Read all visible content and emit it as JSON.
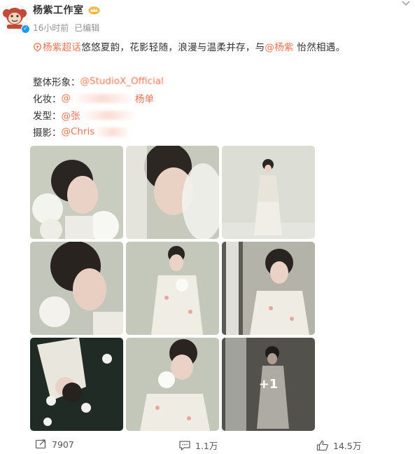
{
  "post": {
    "author": "杨紫工作室",
    "time": "16小时前",
    "edited": "已编辑",
    "topic": "杨紫超话",
    "text_part1": "悠悠夏韵，花影轻随，浪漫与温柔并存，与",
    "mention": "@杨紫",
    "text_part2": " 怡然相遇。",
    "credits": [
      {
        "label": "整体形象：",
        "handle": "@StudioX_Official"
      },
      {
        "label": "化妆：",
        "handle": "@",
        "handle_suffix": "杨单"
      },
      {
        "label": "发型：",
        "handle": "@张"
      },
      {
        "label": "摄影：",
        "handle": "@Chris"
      }
    ],
    "more_photos": "+1"
  },
  "footer": {
    "shares": "7907",
    "comments": "1.1万",
    "likes": "14.5万"
  },
  "colors": {
    "accent": "#eb7350",
    "meta": "#939393"
  },
  "icons": [
    "monkey-avatar-icon",
    "verified-icon",
    "crown-badge-icon",
    "chevron-down-icon",
    "topic-icon",
    "share-icon",
    "comment-icon",
    "like-icon"
  ]
}
